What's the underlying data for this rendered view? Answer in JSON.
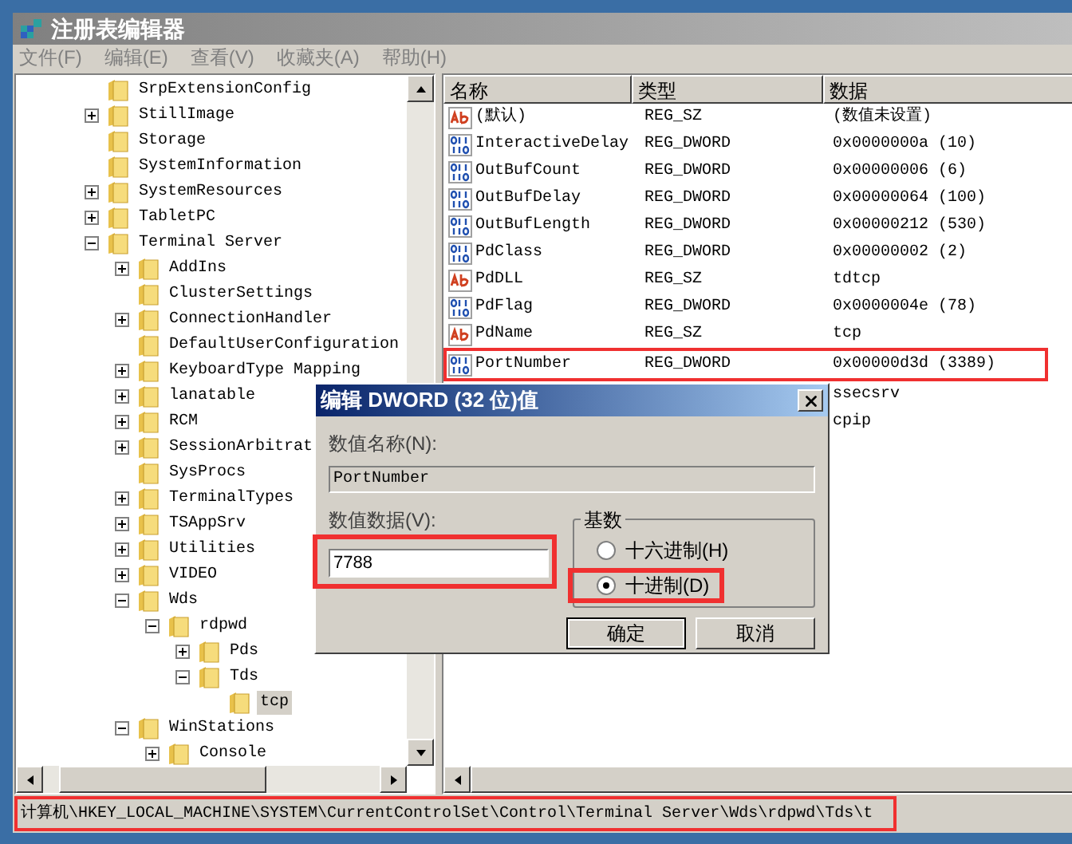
{
  "window": {
    "title": "注册表编辑器"
  },
  "menu": [
    "文件(F)",
    "编辑(E)",
    "查看(V)",
    "收藏夹(A)",
    "帮助(H)"
  ],
  "tree": [
    {
      "label": "SrpExtensionConfig",
      "expandable": false,
      "selected": false
    },
    {
      "label": "StillImage",
      "expandable": true,
      "expanded": false,
      "selected": false
    },
    {
      "label": "Storage",
      "expandable": false,
      "selected": false
    },
    {
      "label": "SystemInformation",
      "expandable": false,
      "selected": false
    },
    {
      "label": "SystemResources",
      "expandable": true,
      "expanded": false,
      "selected": false
    },
    {
      "label": "TabletPC",
      "expandable": true,
      "expanded": false,
      "selected": false
    },
    {
      "label": "Terminal Server",
      "expandable": true,
      "expanded": true,
      "selected": false,
      "children": [
        {
          "label": "AddIns",
          "expandable": true,
          "expanded": false,
          "selected": false
        },
        {
          "label": "ClusterSettings",
          "expandable": false,
          "selected": false
        },
        {
          "label": "ConnectionHandler",
          "expandable": true,
          "expanded": false,
          "selected": false
        },
        {
          "label": "DefaultUserConfiguration",
          "expandable": false,
          "selected": false
        },
        {
          "label": "KeyboardType Mapping",
          "expandable": true,
          "expanded": false,
          "selected": false
        },
        {
          "label": "lanatable",
          "expandable": true,
          "expanded": false,
          "selected": false
        },
        {
          "label": "RCM",
          "expandable": true,
          "expanded": false,
          "selected": false
        },
        {
          "label": "SessionArbitrat",
          "expandable": true,
          "expanded": false,
          "selected": false
        },
        {
          "label": "SysProcs",
          "expandable": false,
          "selected": false
        },
        {
          "label": "TerminalTypes",
          "expandable": true,
          "expanded": false,
          "selected": false
        },
        {
          "label": "TSAppSrv",
          "expandable": true,
          "expanded": false,
          "selected": false
        },
        {
          "label": "Utilities",
          "expandable": true,
          "expanded": false,
          "selected": false
        },
        {
          "label": "VIDEO",
          "expandable": true,
          "expanded": false,
          "selected": false
        },
        {
          "label": "Wds",
          "expandable": true,
          "expanded": true,
          "selected": false,
          "children": [
            {
              "label": "rdpwd",
              "expandable": true,
              "expanded": true,
              "selected": false,
              "children": [
                {
                  "label": "Pds",
                  "expandable": true,
                  "expanded": false,
                  "selected": false
                },
                {
                  "label": "Tds",
                  "expandable": true,
                  "expanded": true,
                  "selected": false,
                  "children": [
                    {
                      "label": "tcp",
                      "expandable": false,
                      "selected": true
                    }
                  ]
                }
              ]
            }
          ]
        },
        {
          "label": "WinStations",
          "expandable": true,
          "expanded": true,
          "selected": false,
          "children": [
            {
              "label": "Console",
              "expandable": true,
              "expanded": false,
              "selected": false
            }
          ]
        }
      ]
    }
  ],
  "table": {
    "columns": [
      "名称",
      "类型",
      "数据"
    ],
    "rows": [
      {
        "kind": "sz",
        "name": "(默认)",
        "type": "REG_SZ",
        "data": "(数值未设置)",
        "highlighted": false
      },
      {
        "kind": "dword",
        "name": "InteractiveDelay",
        "type": "REG_DWORD",
        "data": "0x0000000a (10)",
        "highlighted": false
      },
      {
        "kind": "dword",
        "name": "OutBufCount",
        "type": "REG_DWORD",
        "data": "0x00000006 (6)",
        "highlighted": false
      },
      {
        "kind": "dword",
        "name": "OutBufDelay",
        "type": "REG_DWORD",
        "data": "0x00000064 (100)",
        "highlighted": false
      },
      {
        "kind": "dword",
        "name": "OutBufLength",
        "type": "REG_DWORD",
        "data": "0x00000212 (530)",
        "highlighted": false
      },
      {
        "kind": "dword",
        "name": "PdClass",
        "type": "REG_DWORD",
        "data": "0x00000002 (2)",
        "highlighted": false
      },
      {
        "kind": "sz",
        "name": "PdDLL",
        "type": "REG_SZ",
        "data": "tdtcp",
        "highlighted": false
      },
      {
        "kind": "dword",
        "name": "PdFlag",
        "type": "REG_DWORD",
        "data": "0x0000004e (78)",
        "highlighted": false
      },
      {
        "kind": "sz",
        "name": "PdName",
        "type": "REG_SZ",
        "data": "tcp",
        "highlighted": false
      },
      {
        "kind": "dword",
        "name": "PortNumber",
        "type": "REG_DWORD",
        "data": "0x00000d3d (3389)",
        "highlighted": true
      },
      {
        "data": "ssecsrv",
        "highlighted": false
      },
      {
        "data": "cpip",
        "highlighted": false
      }
    ]
  },
  "dialog": {
    "title": "编辑 DWORD (32 位)值",
    "name_label": "数值名称(N):",
    "name_value": "PortNumber",
    "data_label": "数值数据(V):",
    "data_value": "7788",
    "data_highlighted": true,
    "base_label": "基数",
    "base_options": [
      {
        "label": "十六进制(H)",
        "selected": false,
        "highlighted": false
      },
      {
        "label": "十进制(D)",
        "selected": true,
        "highlighted": true
      }
    ],
    "buttons": [
      "确定",
      "取消"
    ]
  },
  "status_bar": {
    "text": "计算机\\HKEY_LOCAL_MACHINE\\SYSTEM\\CurrentControlSet\\Control\\Terminal Server\\Wds\\rdpwd\\Tds\\t",
    "highlighted": true
  }
}
